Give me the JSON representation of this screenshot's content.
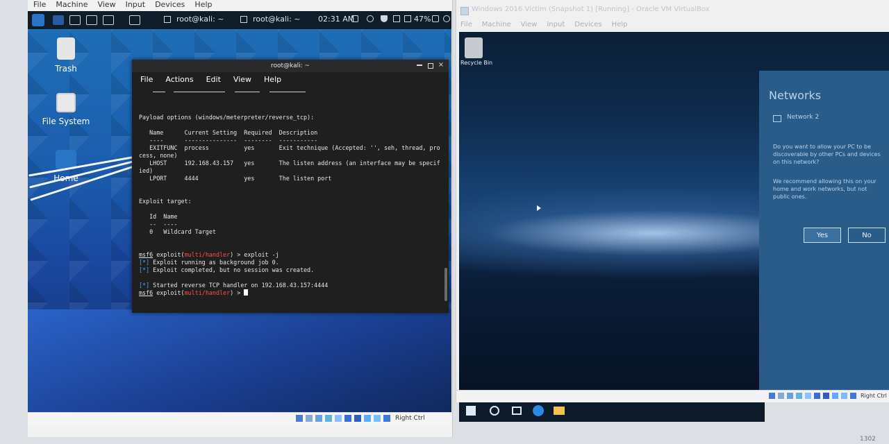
{
  "left_vm": {
    "menu": [
      "File",
      "Machine",
      "View",
      "Input",
      "Devices",
      "Help"
    ],
    "topbar": {
      "tasks": [
        "root@kali: ~",
        "root@kali: ~"
      ],
      "clock": "02:31 AM",
      "battery": "47%"
    },
    "desktop_icons": [
      "Trash",
      "File System",
      "Home"
    ],
    "terminal": {
      "title": "root@kali: ~",
      "menu": [
        "File",
        "Actions",
        "Edit",
        "View",
        "Help"
      ]
    },
    "status": {
      "hostkey": "Right Ctrl"
    }
  },
  "terminal_output": {
    "line_payload_options": "Payload options (windows/meterpreter/reverse_tcp):",
    "header": "   Name      Current Setting  Required  Description",
    "underline": "   ----      ---------------  --------  -----------",
    "row_exitfunc": "   EXITFUNC  process          yes       Exit technique (Accepted: '', seh, thread, pro",
    "row_exitfunc_cont": "cess, none)",
    "row_lhost": "   LHOST     192.168.43.157   yes       The listen address (an interface may be specif",
    "row_lhost_cont": "ied)",
    "row_lport": "   LPORT     4444             yes       The listen port",
    "exploit_target": "Exploit target:",
    "id_name": "   Id  Name",
    "id_name_ul": "   --  ----",
    "target_row": "   0   Wildcard Target",
    "cmd_msf6_1": "msf6",
    "cmd_exploit_word_1": " exploit(",
    "cmd_module_1": "multi/handler",
    "cmd_tail_1": ") > exploit -j",
    "info_1": "[*]",
    "info_1_text": " Exploit running as background job 0.",
    "info_2": "[*]",
    "info_2_text": " Exploit completed, but no session was created.",
    "info_3": "[*]",
    "info_3_text": " Started reverse TCP handler on 192.168.43.157:4444",
    "cmd_msf6_2": "msf6",
    "cmd_exploit_word_2": " exploit(",
    "cmd_module_2": "multi/handler",
    "cmd_tail_2": ") > "
  },
  "right_vm": {
    "window_title": "Windows 2016 Victim (Snapshot 1) [Running] - Oracle VM VirtualBox",
    "menu": [
      "File",
      "Machine",
      "View",
      "Input",
      "Devices",
      "Help"
    ],
    "desktop_icon": "Recycle Bin",
    "networks_panel": {
      "title": "Networks",
      "network_name": "Network 2",
      "question": "Do you want to allow your PC to be discoverable by other PCs and devices on this network?",
      "recommendation": "We recommend allowing this on your home and work networks, but not public ones.",
      "yes": "Yes",
      "no": "No"
    },
    "status": {
      "hostkey": "Right Ctrl"
    }
  },
  "bottom_corner": "1302",
  "colors": {
    "kali_blue": "#1b5fae",
    "terminal_bg": "#1f1f1f",
    "msf_red": "#ff4d4d",
    "info_blue": "#4aa3ff",
    "win_panel": "#2a5c89"
  }
}
